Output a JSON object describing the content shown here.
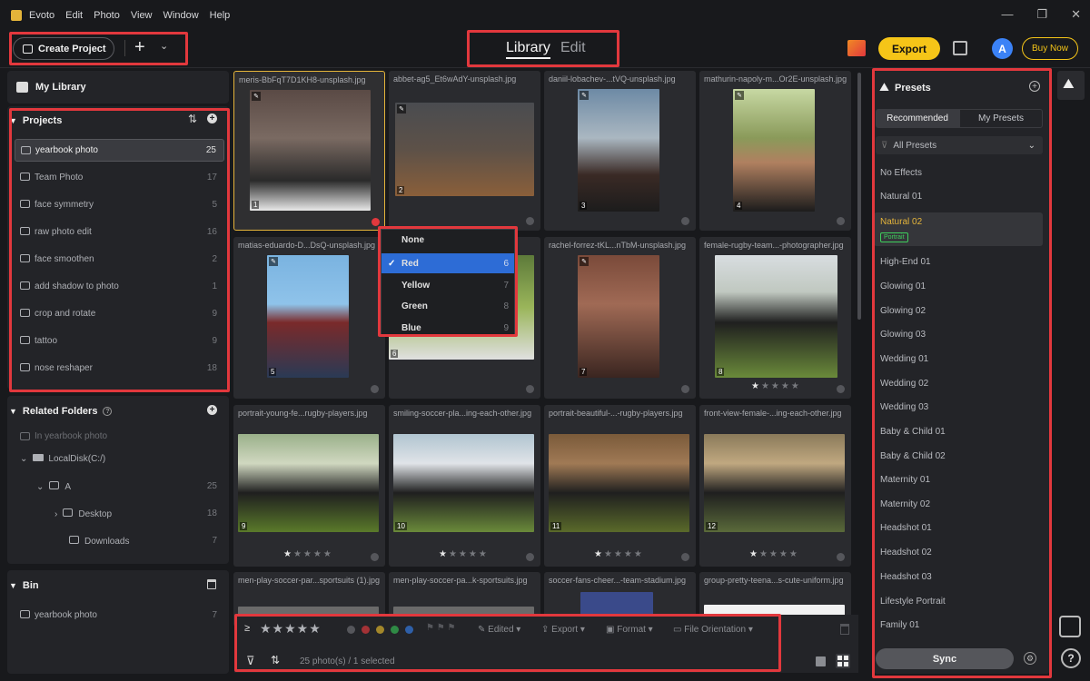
{
  "menubar": {
    "app_name": "Evoto",
    "items": [
      "Edit",
      "Photo",
      "View",
      "Window",
      "Help"
    ]
  },
  "toolbar": {
    "create_project": "Create Project",
    "tabs": {
      "library": "Library",
      "edit": "Edit"
    },
    "export": "Export",
    "avatar": "A",
    "buy_now": "Buy Now"
  },
  "sidebar": {
    "my_library": "My Library",
    "projects_title": "Projects",
    "projects": [
      {
        "label": "yearbook photo",
        "count": "25"
      },
      {
        "label": "Team Photo",
        "count": "17"
      },
      {
        "label": "face symmetry",
        "count": "5"
      },
      {
        "label": "raw photo edit",
        "count": "16"
      },
      {
        "label": "face smoothen",
        "count": "2"
      },
      {
        "label": "add shadow to photo",
        "count": "1"
      },
      {
        "label": "crop and rotate",
        "count": "9"
      },
      {
        "label": "tattoo",
        "count": "9"
      },
      {
        "label": "nose reshaper",
        "count": "18"
      }
    ],
    "related_title": "Related Folders",
    "related": {
      "in_project": "In yearbook photo",
      "disk": "LocalDisk(C:/)",
      "folder_a": "A",
      "folder_a_count": "25",
      "desktop": "Desktop",
      "desktop_count": "18",
      "downloads": "Downloads",
      "downloads_count": "7"
    },
    "bin_title": "Bin",
    "bin_item": {
      "label": "yearbook photo",
      "count": "7"
    }
  },
  "grid": {
    "cards": [
      {
        "name": "meris-BbFqT7D1KH8-unsplash.jpg",
        "num": "1"
      },
      {
        "name": "abbet-ag5_Et6wAdY-unsplash.jpg",
        "num": "2"
      },
      {
        "name": "daniil-lobachev-...tVQ-unsplash.jpg",
        "num": "3"
      },
      {
        "name": "mathurin-napoly-m...Or2E-unsplash.jpg",
        "num": "4"
      },
      {
        "name": "matias-eduardo-D...DsQ-unsplash.jpg",
        "num": "5"
      },
      {
        "name": "",
        "num": "6"
      },
      {
        "name": "rachel-forrez-tKL...nTbM-unsplash.jpg",
        "num": "7"
      },
      {
        "name": "female-rugby-team...-photographer.jpg",
        "num": "8"
      },
      {
        "name": "portrait-young-fe...rugby-players.jpg",
        "num": "9"
      },
      {
        "name": "smiling-soccer-pla...ing-each-other.jpg",
        "num": "10"
      },
      {
        "name": "portrait-beautiful-...-rugby-players.jpg",
        "num": "11"
      },
      {
        "name": "front-view-female-...ing-each-other.jpg",
        "num": "12"
      },
      {
        "name": "men-play-soccer-par...sportsuits (1).jpg",
        "num": ""
      },
      {
        "name": "men-play-soccer-pa...k-sportsuits.jpg",
        "num": ""
      },
      {
        "name": "soccer-fans-cheer...-team-stadium.jpg",
        "num": ""
      },
      {
        "name": "group-pretty-teena...s-cute-uniform.jpg",
        "num": ""
      }
    ]
  },
  "color_dropdown": {
    "items": [
      {
        "label": "None",
        "count": ""
      },
      {
        "label": "Red",
        "count": "6"
      },
      {
        "label": "Yellow",
        "count": "7"
      },
      {
        "label": "Green",
        "count": "8"
      },
      {
        "label": "Blue",
        "count": "9"
      }
    ]
  },
  "bottom_bar": {
    "gte": "≥",
    "edited": "Edited",
    "export": "Export",
    "format": "Format",
    "orientation": "File Orientation",
    "status": "25 photo(s) / 1 selected"
  },
  "presets": {
    "title": "Presets",
    "tab_recommended": "Recommended",
    "tab_my": "My Presets",
    "filter": "All Presets",
    "items": [
      "No Effects",
      "Natural 01",
      "Natural 02",
      "High-End 01",
      "Glowing 01",
      "Glowing 02",
      "Glowing 03",
      "Wedding 01",
      "Wedding 02",
      "Wedding 03",
      "Baby & Child 01",
      "Baby & Child 02",
      "Maternity 01",
      "Maternity 02",
      "Headshot 01",
      "Headshot 02",
      "Headshot 03",
      "Lifestyle Portrait",
      "Family 01"
    ],
    "badge": "Portrait",
    "sync": "Sync"
  },
  "colors": {
    "accent_yellow": "#f5c518",
    "highlight_red": "#e2383d",
    "selection_blue": "#2d6cd6",
    "label_red": "#e2383d",
    "label_yellow": "#e4b43a",
    "label_green": "#3ecf5d",
    "label_blue": "#3b82f6"
  }
}
